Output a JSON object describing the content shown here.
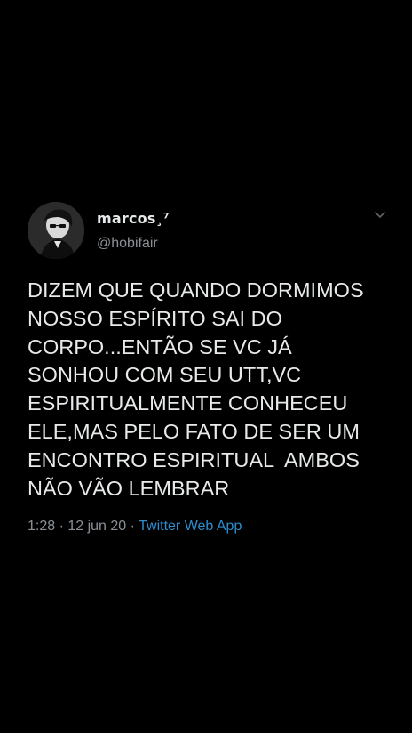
{
  "tweet": {
    "author": {
      "display_name": "marcos¸⁷",
      "handle": "@hobifair",
      "avatar_icon": "profile-photo"
    },
    "menu_icon": "chevron-down-icon",
    "text": "DIZEM QUE QUANDO DORMIMOS\nNOSSO ESPÍRITO SAI DO\nCORPO...ENTÃO SE VC JÁ\nSONHOU COM SEU UTT,VC\nESPIRITUALMENTE CONHECEU\nELE,MAS PELO FATO DE SER UM\nENCONTRO ESPIRITUAL  AMBOS\nNÃO VÃO LEMBRAR",
    "meta": {
      "time": "1:28",
      "separator": " · ",
      "date": "12 jun 20",
      "source": "Twitter Web App"
    },
    "colors": {
      "background": "#000000",
      "text": "#e7e9ea",
      "secondary": "#8b9096",
      "link": "#2e8ccd"
    }
  }
}
